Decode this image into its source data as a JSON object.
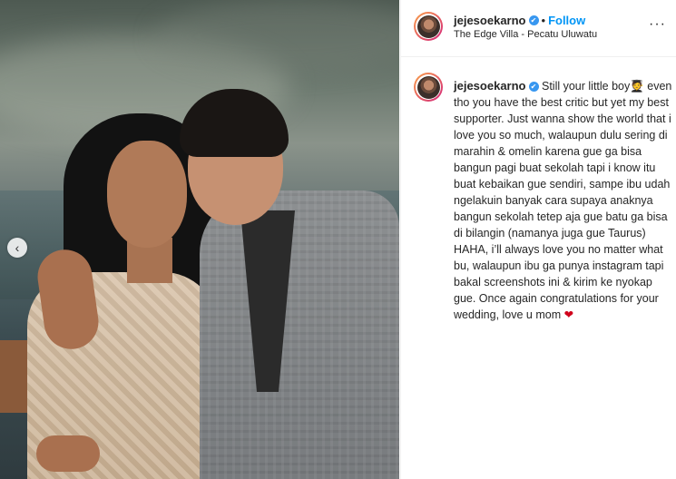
{
  "post": {
    "username": "jejesoekarno",
    "verified_mark": "✔",
    "separator": "•",
    "follow_label": "Follow",
    "location": "The Edge Villa - Pecatu Uluwatu",
    "more_label": "···",
    "carousel_prev": "‹",
    "caption_text": "Still your little boy🧑‍🎓 even tho you have the best critic but yet my best supporter. Just wanna show the world that i love you so much, walaupun dulu sering di marahin & omelin karena gue ga bisa bangun pagi buat sekolah tapi i know itu buat kebaikan gue sendiri, sampe ibu udah ngelakuin banyak cara supaya anaknya bangun sekolah tetep aja gue batu ga bisa di bilangin (namanya juga gue Taurus) HAHA, i’ll always love you no matter what bu, walaupun ibu ga punya instagram tapi bakal screenshots ini & kirim ke nyokap gue. Once again congratulations for your wedding, love u mom",
    "caption_emoji_end": "❤"
  },
  "icons": {
    "verified": "verified-badge-icon",
    "more": "more-options-icon",
    "prev": "chevron-left-icon",
    "heart": "heart-icon"
  },
  "colors": {
    "follow": "#0095f6",
    "verified": "#3897f0",
    "heart": "#d0021b"
  }
}
